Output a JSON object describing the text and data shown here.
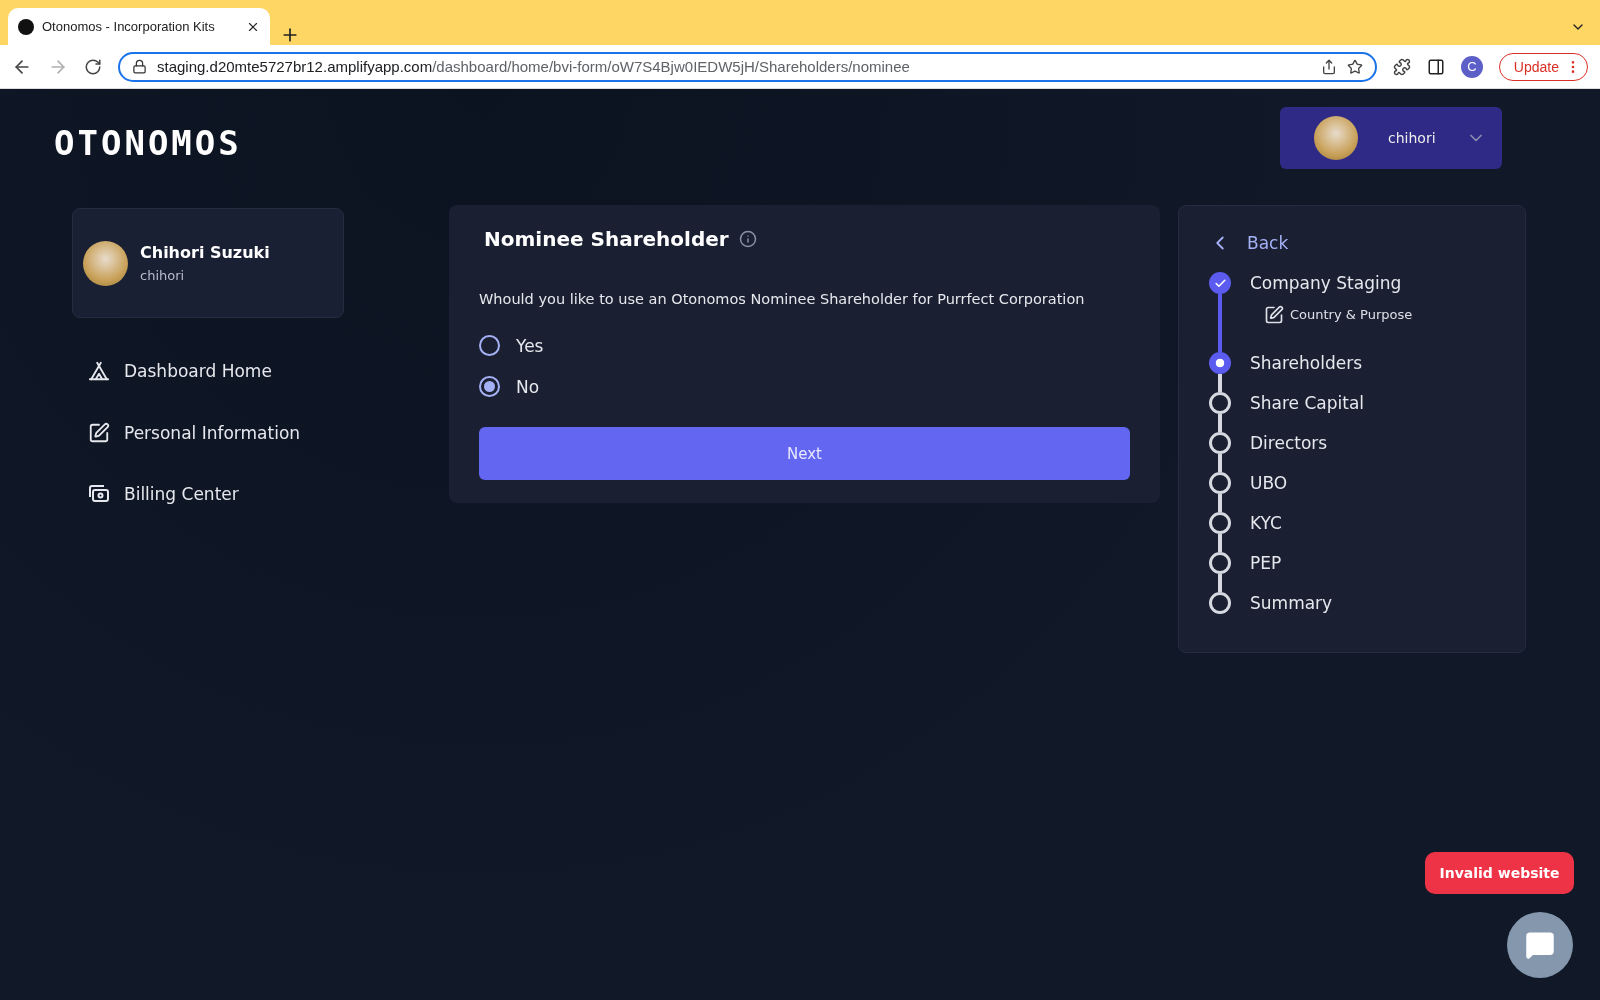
{
  "browser": {
    "tab_title": "Otonomos - Incorporation Kits",
    "url_host": "staging.d20mte5727br12.amplifyapp.com",
    "url_path": "/dashboard/home/bvi-form/oW7S4Bjw0IEDW5jH/Shareholders/nominee",
    "profile_initial": "C",
    "update_label": "Update",
    "forward_disabled": true
  },
  "logo": "OTONOMOS",
  "user_menu": {
    "username": "chihori"
  },
  "profile": {
    "name": "Chihori Suzuki",
    "handle": "chihori"
  },
  "nav": [
    {
      "label": "Dashboard Home",
      "kind": "home"
    },
    {
      "label": "Personal Information",
      "kind": "edit"
    },
    {
      "label": "Billing Center",
      "kind": "billing"
    }
  ],
  "form": {
    "title": "Nominee Shareholder",
    "question": "Whould you like to use an Otonomos Nominee Shareholder for Purrfect Corporation",
    "options": [
      {
        "label": "Yes",
        "selected": false
      },
      {
        "label": "No",
        "selected": true
      }
    ],
    "next_label": "Next"
  },
  "stepper": {
    "back_label": "Back",
    "steps": [
      {
        "label": "Company Staging",
        "completed": true,
        "current": false,
        "children": [
          {
            "label": "Country & Purpose"
          }
        ]
      },
      {
        "label": "Shareholders",
        "completed": false,
        "current": true
      },
      {
        "label": "Share Capital",
        "completed": false,
        "current": false
      },
      {
        "label": "Directors",
        "completed": false,
        "current": false
      },
      {
        "label": "UBO",
        "completed": false,
        "current": false
      },
      {
        "label": "KYC",
        "completed": false,
        "current": false
      },
      {
        "label": "PEP",
        "completed": false,
        "current": false
      },
      {
        "label": "Summary",
        "completed": false,
        "current": false
      }
    ]
  },
  "toast": "Invalid website"
}
